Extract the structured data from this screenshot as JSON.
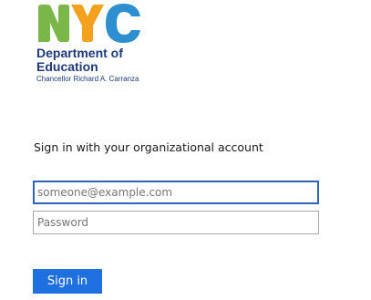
{
  "branding": {
    "logo_text": "NYC",
    "line1": "Department of",
    "line2": "Education",
    "line3": "Chancellor Richard A. Carranza",
    "colors": {
      "n": "#7ab648",
      "y": "#f4a21e",
      "c": "#2d8fd0",
      "text": "#1f3a7a"
    }
  },
  "signin": {
    "heading": "Sign in with your organizational account",
    "email_placeholder": "someone@example.com",
    "password_placeholder": "Password",
    "submit_label": "Sign in",
    "accent_color": "#1e6fe0"
  }
}
